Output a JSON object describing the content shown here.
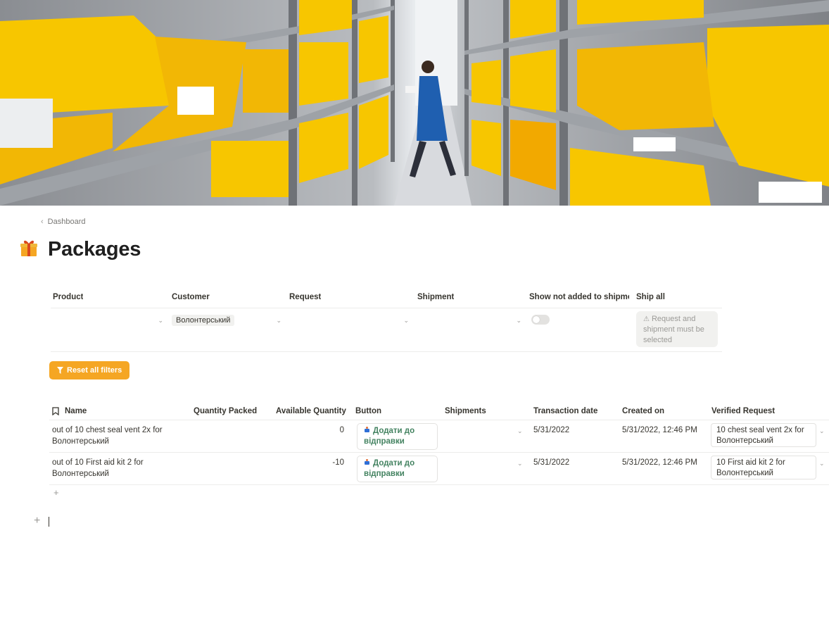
{
  "breadcrumb": {
    "label": "Dashboard"
  },
  "page": {
    "title": "Packages",
    "icon": "gift-icon"
  },
  "filters": {
    "headers": {
      "product": "Product",
      "customer": "Customer",
      "request": "Request",
      "shipment": "Shipment",
      "show_not_added": "Show not added to shipment",
      "ship_all": "Ship all"
    },
    "customer_value": "Волонтерський",
    "ship_all_button": "Request and shipment must be selected",
    "reset_label": "Reset all filters"
  },
  "table": {
    "columns": {
      "name": "Name",
      "quantity_packed": "Quantity Packed",
      "available_quantity": "Available Quantity",
      "button": "Button",
      "shipments": "Shipments",
      "transaction_date": "Transaction date",
      "created_on": "Created on",
      "verified_request": "Verified Request"
    },
    "rows": [
      {
        "name": " out of 10 chest seal vent 2x for Волонтерський",
        "quantity_packed": "",
        "available_quantity": "0",
        "button": "Додати до відправки",
        "transaction_date": "5/31/2022",
        "created_on": "5/31/2022, 12:46 PM",
        "verified_request": "10 chest seal vent 2x for Волонтерський"
      },
      {
        "name": " out of 10 First aid kit 2 for Волонтерський",
        "quantity_packed": "",
        "available_quantity": "-10",
        "button": "Додати до відправки",
        "transaction_date": "5/31/2022",
        "created_on": "5/31/2022, 12:46 PM",
        "verified_request": "10 First aid kit 2 for Волонтерський"
      }
    ]
  },
  "colors": {
    "accent": "#f5a623",
    "button_text": "#448361",
    "bins": "#f7c600"
  }
}
